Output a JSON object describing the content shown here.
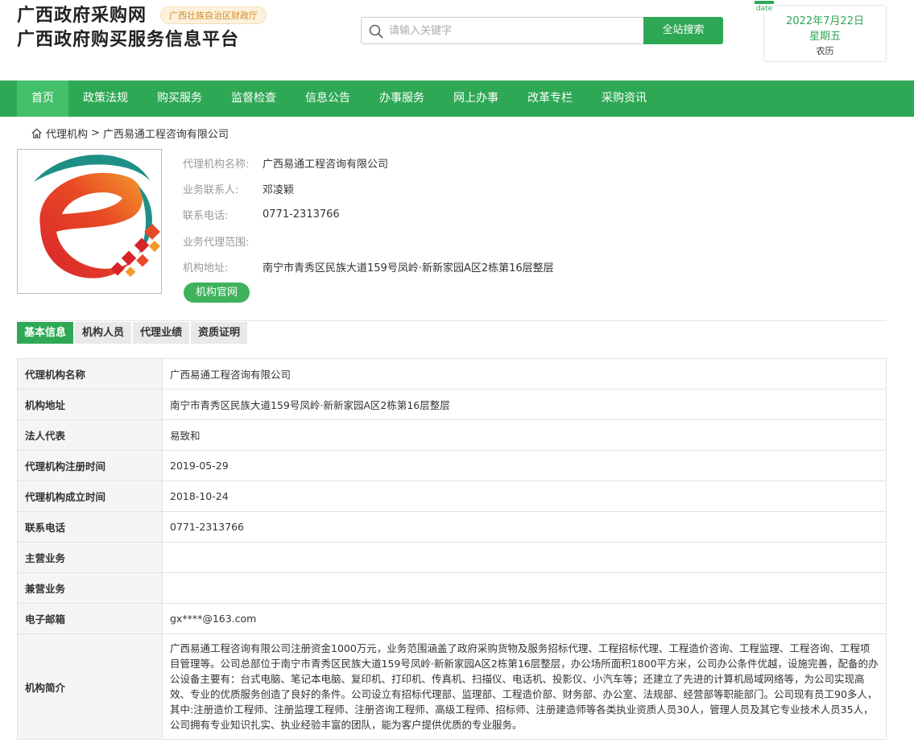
{
  "header": {
    "site_title": "广西政府采购网",
    "site_tag": "广西壮族自治区财政厅",
    "site_subtitle": "广西政府购买服务信息平台"
  },
  "search": {
    "placeholder": "请输入关键字",
    "button_label": "全站搜索",
    "icon": "search-icon"
  },
  "date_card": {
    "tab_label": "date",
    "date": "2022年7月22日",
    "weekday": "星期五",
    "lunar": "农历"
  },
  "nav": {
    "items": [
      {
        "label": "首页",
        "active": true
      },
      {
        "label": "政策法规"
      },
      {
        "label": "购买服务"
      },
      {
        "label": "监督检查"
      },
      {
        "label": "信息公告"
      },
      {
        "label": "办事服务"
      },
      {
        "label": "网上办事"
      },
      {
        "label": "改革专栏"
      },
      {
        "label": "采购资讯"
      }
    ]
  },
  "breadcrumb": {
    "icon": "home-icon",
    "parent": "代理机构",
    "separator": ">",
    "current": "广西易通工程咨询有限公司"
  },
  "profile": {
    "logo": "agency-logo",
    "rows": [
      {
        "label": "代理机构名称:",
        "value": "广西易通工程咨询有限公司"
      },
      {
        "label": "业务联系人:",
        "value": "邓凌颖"
      },
      {
        "label": "联系电话:",
        "value": "0771-2313766"
      },
      {
        "label": "业务代理范围:",
        "value": ""
      },
      {
        "label": "机构地址:",
        "value": "南宁市青秀区民族大道159号凤岭·新新家园A区2栋第16层整层"
      }
    ],
    "website_button": "机构官网"
  },
  "tabs": [
    {
      "label": "基本信息",
      "active": true
    },
    {
      "label": "机构人员"
    },
    {
      "label": "代理业绩"
    },
    {
      "label": "资质证明"
    }
  ],
  "details": [
    {
      "label": "代理机构名称",
      "value": "广西易通工程咨询有限公司"
    },
    {
      "label": "机构地址",
      "value": "南宁市青秀区民族大道159号凤岭·新新家园A区2栋第16层整层"
    },
    {
      "label": "法人代表",
      "value": "易致和"
    },
    {
      "label": "代理机构注册时间",
      "value": "2019-05-29"
    },
    {
      "label": "代理机构成立时间",
      "value": "2018-10-24"
    },
    {
      "label": "联系电话",
      "value": "0771-2313766"
    },
    {
      "label": "主营业务",
      "value": ""
    },
    {
      "label": "兼营业务",
      "value": ""
    },
    {
      "label": "电子邮箱",
      "value": "gx****@163.com"
    },
    {
      "label": "机构简介",
      "value": "广西易通工程咨询有限公司注册资金1000万元，业务范围涵盖了政府采购货物及服务招标代理、工程招标代理、工程造价咨询、工程监理、工程咨询、工程项目管理等。公司总部位于南宁市青秀区民族大道159号凤岭·新新家园A区2栋第16层整层，办公场所面积1800平方米，公司办公条件优越，设施完善，配备的办公设备主要有：台式电脑、笔记本电脑、复印机、打印机、传真机、扫描仪、电话机、投影仪、小汽车等；还建立了先进的计算机局域网络等，为公司实现高效、专业的优质服务创造了良好的条件。公司设立有招标代理部、监理部、工程造价部、财务部、办公室、法规部、经营部等职能部门。公司现有员工90多人，其中:注册造价工程师、注册监理工程师、注册咨询工程师、高级工程师、招标师、注册建造师等各类执业资质人员30人，管理人员及其它专业技术人员35人，公司拥有专业知识扎实、执业经验丰富的团队，能为客户提供优质的专业服务。"
    }
  ],
  "colors": {
    "brand_green": "#2fa855",
    "nav_active": "#45c06a",
    "tag_bg": "#fdf1de",
    "tag_text": "#d18d1a"
  }
}
